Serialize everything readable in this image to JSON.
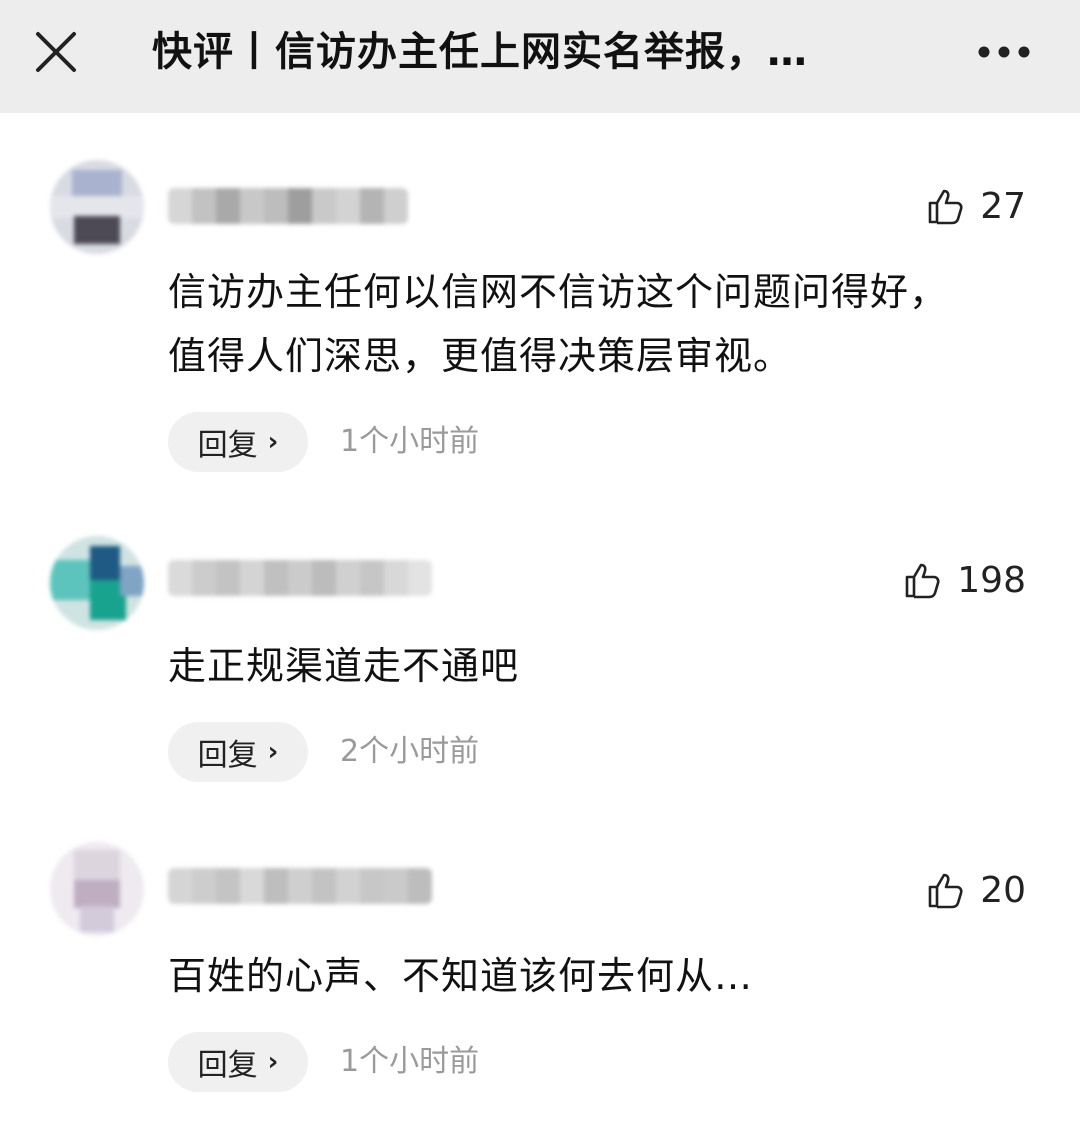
{
  "header": {
    "title": "快评丨信访办主任上网实名举报，…",
    "close_icon": "close-icon",
    "more_icon": "more-horizontal-icon"
  },
  "comments": [
    {
      "text": "信访办主任何以信网不信访这个问题问得好，值得人们深思，更值得决策层审视。",
      "likes": "27",
      "reply_label": "回复",
      "time": "1个小时前"
    },
    {
      "text": "走正规渠道走不通吧",
      "likes": "198",
      "reply_label": "回复",
      "time": "2个小时前"
    },
    {
      "text": "百姓的心声、不知道该何去何从…",
      "likes": "20",
      "reply_label": "回复",
      "time": "1个小时前"
    }
  ],
  "icons": {
    "like": "thumbs-up-icon",
    "reply_chevron": "chevron-right-icon"
  },
  "colors": {
    "header_bg": "#ededed",
    "reply_bg": "#f0f0f0",
    "time_text": "#9a9a9a"
  }
}
